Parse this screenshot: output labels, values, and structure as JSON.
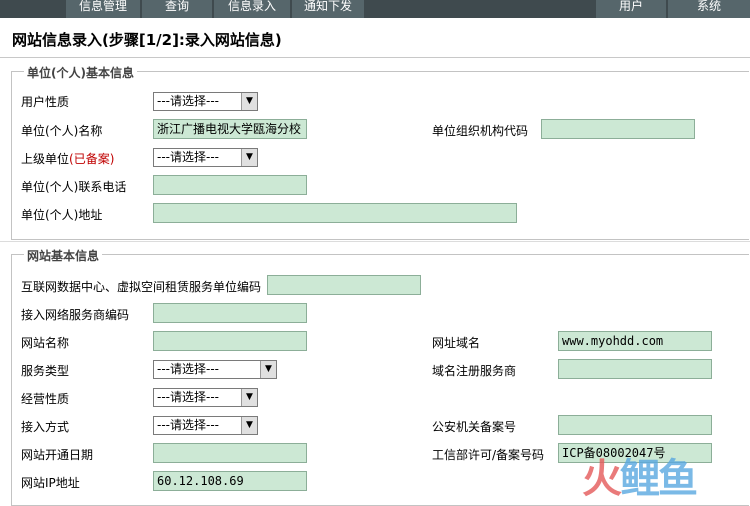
{
  "nav": {
    "tabs": [
      "信息管理",
      "查询",
      "信息录入",
      "通知下发"
    ],
    "right_tabs": [
      "用户",
      "系统"
    ]
  },
  "page_title": "网站信息录入(步骤[1/2]:录入网站信息)",
  "section1": {
    "legend": "单位(个人)基本信息",
    "user_type_label": "用户性质",
    "user_type_value": "---请选择---",
    "unit_name_label": "单位(个人)名称",
    "unit_name_value": "浙江广播电视大学瓯海分校",
    "org_code_label": "单位组织机构代码",
    "org_code_value": "",
    "parent_unit_label": "上级单位",
    "parent_unit_note": "(已备案)",
    "parent_unit_value": "---请选择---",
    "phone_label": "单位(个人)联系电话",
    "phone_value": "",
    "address_label": "单位(个人)地址",
    "address_value": ""
  },
  "section2": {
    "legend": "网站基本信息",
    "idc_code_label": "互联网数据中心、虚拟空间租赁服务单位编码",
    "idc_code_value": "",
    "isp_code_label": "接入网络服务商编码",
    "isp_code_value": "",
    "site_name_label": "网站名称",
    "site_name_value": "",
    "domain_label": "网址域名",
    "domain_value": "www.myohdd.com",
    "service_type_label": "服务类型",
    "service_type_value": "---请选择---",
    "registrar_label": "域名注册服务商",
    "registrar_value": "",
    "business_nature_label": "经营性质",
    "business_nature_value": "---请选择---",
    "access_method_label": "接入方式",
    "access_method_value": "---请选择---",
    "police_record_label": "公安机关备案号",
    "police_record_value": "",
    "open_date_label": "网站开通日期",
    "open_date_value": "",
    "icp_label": "工信部许可/备案号码",
    "icp_value": "ICP备08002047号",
    "ip_label": "网站IP地址",
    "ip_value": "60.12.108.69"
  },
  "watermark": "火鲤鱼"
}
